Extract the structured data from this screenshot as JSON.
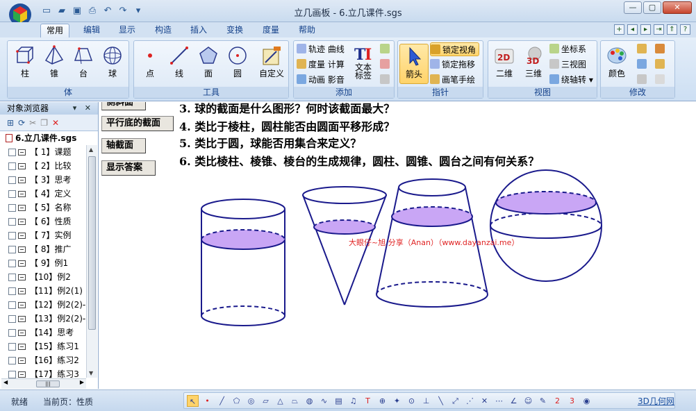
{
  "window": {
    "title": "立几画板 - 6.立几课件.sgs"
  },
  "quick_access": [
    "new-icon",
    "open-icon",
    "save-icon",
    "print-icon",
    "undo-icon",
    "redo-icon",
    "dropdown-icon"
  ],
  "tabs": [
    "常用",
    "编辑",
    "显示",
    "构造",
    "插入",
    "变换",
    "度量",
    "帮助"
  ],
  "active_tab": "常用",
  "ribbon": {
    "groups": [
      {
        "label": "体",
        "items": [
          "柱",
          "锥",
          "台",
          "球"
        ]
      },
      {
        "label": "工具",
        "items": [
          "点",
          "线",
          "面",
          "圆",
          "自定义"
        ]
      },
      {
        "label": "添加",
        "small": [
          "轨迹 曲线",
          "度量 计算",
          "动画 影音"
        ],
        "big": "文本\n标签"
      },
      {
        "label": "指针",
        "big": "箭头",
        "small": [
          "锁定视角",
          "锁定拖移",
          "画笔手绘"
        ]
      },
      {
        "label": "视图",
        "big": [
          "二维",
          "三维"
        ],
        "small": [
          "坐标系",
          "三视图",
          "绕轴转"
        ]
      },
      {
        "label": "修改",
        "big": "颜色"
      }
    ]
  },
  "panel": {
    "title": "对象浏览器",
    "root": "6.立几课件.sgs",
    "items": [
      "【 1】课题",
      "【 2】比较",
      "【 3】思考",
      "【 4】定义",
      "【 5】名称",
      "【 6】性质",
      "【 7】实例",
      "【 8】推广",
      "【 9】例1",
      "【10】例2",
      "【11】例2(1)",
      "【12】例2(2)-",
      "【13】例2(2)-",
      "【14】思考",
      "【15】练习1",
      "【16】练习2",
      "【17】练习3"
    ]
  },
  "canvas": {
    "buttons": [
      "侧斜面",
      "平行底的截面",
      "轴截面",
      "显示答案"
    ],
    "questions": [
      "3.  球的截面是什么图形？何时该截面最大？",
      "4.  类比于棱柱，圆柱能否由圆面平移形成？",
      "5.  类比于圆，球能否用集合来定义？",
      "6.  类比棱柱、棱锥、棱台的生成规律，圆柱、圆锥、圆台之间有何关系？"
    ],
    "watermark": "大眼仔~旭 分享（Anan）（www.dayanzai.me）",
    "colors": {
      "stroke": "#1a1a8c",
      "section_fill": "#c9a6f5"
    }
  },
  "statusbar": {
    "state": "就绪",
    "page": "当前页：性质",
    "link": "3D几何网"
  }
}
